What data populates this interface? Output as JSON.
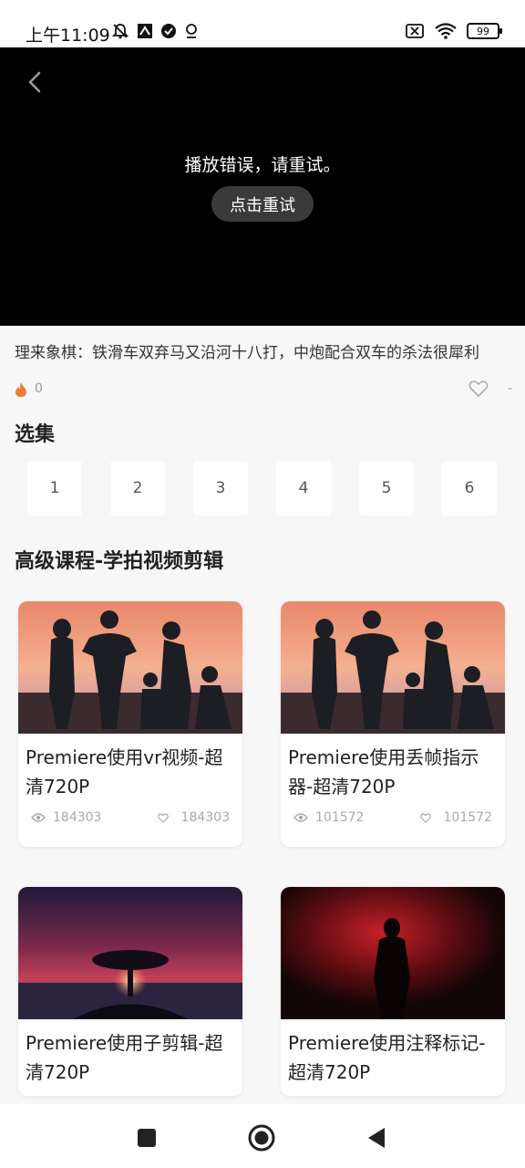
{
  "status_bar": {
    "time": "上午11:09",
    "battery": "99",
    "icons_left": [
      "mute-bell-icon",
      "flag-icon",
      "check-circle-icon",
      "location-pin-icon"
    ],
    "icons_right": [
      "sim-off-icon",
      "wifi-icon",
      "battery-icon"
    ]
  },
  "player": {
    "error_message": "播放错误，请重试。",
    "retry_label": "点击重试"
  },
  "video": {
    "title": "理来象棋：铁滑车双弃马又沿河十八打，中炮配合双车的杀法很犀利",
    "fire_count": "0",
    "like_count": "-"
  },
  "episodes": {
    "heading": "选集",
    "items": [
      "1",
      "2",
      "3",
      "4",
      "5",
      "6"
    ]
  },
  "courses": {
    "heading": "高级课程-学拍视频剪辑",
    "items": [
      {
        "title": "Premiere使用vr视频-超清720P",
        "views": "184303",
        "likes": "184303",
        "thumb": "family-sunset"
      },
      {
        "title": "Premiere使用丢帧指示器-超清720P",
        "views": "101572",
        "likes": "101572",
        "thumb": "family-sunset"
      },
      {
        "title": "Premiere使用子剪辑-超清720P",
        "thumb": "tree-sunset"
      },
      {
        "title": "Premiere使用注释标记-超清720P",
        "thumb": "red-smoke-figure"
      }
    ]
  },
  "colors": {
    "accent_fire": "#f07a3a",
    "video_bg": "#000000"
  }
}
